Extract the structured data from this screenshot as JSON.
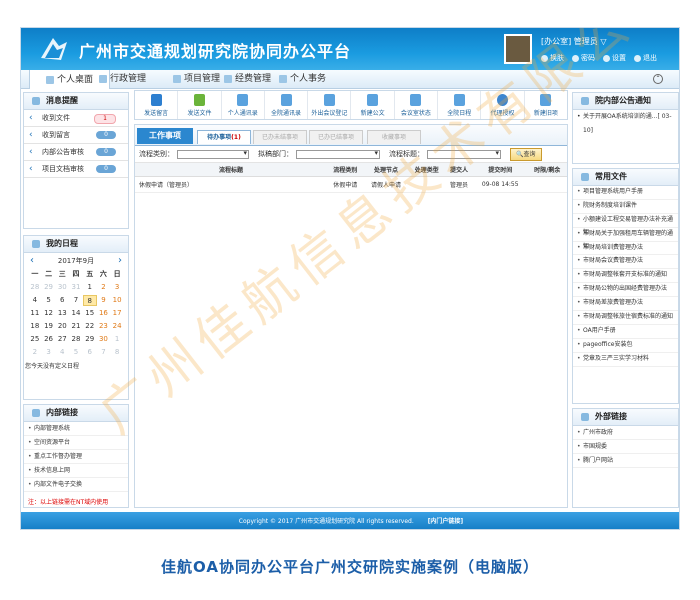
{
  "app": {
    "title": "广州市交通规划研究院协同办公平台"
  },
  "user": {
    "name": "[办公室] 管理员 ▽",
    "actions": [
      "换肤",
      "密码",
      "设置",
      "退出"
    ]
  },
  "nav": {
    "items": [
      "个人桌面",
      "行政管理",
      "项目管理",
      "经费管理",
      "个人事务"
    ]
  },
  "messages": {
    "title": "消息提醒",
    "items": [
      {
        "label": "收到文件",
        "count": "1",
        "highlight": true
      },
      {
        "label": "收到留言",
        "count": "0",
        "highlight": false
      },
      {
        "label": "内部公告审核",
        "count": "0",
        "highlight": false
      },
      {
        "label": "项目文档审核",
        "count": "0",
        "highlight": false
      }
    ]
  },
  "schedule": {
    "title": "我的日程",
    "month": "2017年9月",
    "weekdays": [
      "一",
      "二",
      "三",
      "四",
      "五",
      "六",
      "日"
    ],
    "days": [
      "28",
      "29",
      "30",
      "31",
      "1",
      "2",
      "3",
      "4",
      "5",
      "6",
      "7",
      "8",
      "9",
      "10",
      "11",
      "12",
      "13",
      "14",
      "15",
      "16",
      "17",
      "18",
      "19",
      "20",
      "21",
      "22",
      "23",
      "24",
      "25",
      "26",
      "27",
      "28",
      "29",
      "30",
      "1",
      "2",
      "3",
      "4",
      "5",
      "6",
      "7",
      "8"
    ],
    "note": "您今天没有定义日程"
  },
  "links": {
    "title": "内部链接",
    "items": [
      "内部管理系统",
      "空间资源平台",
      "重点工作督办管理",
      "技术信息上网",
      "内部文件电子交换"
    ],
    "note": "注：以上链接需在NT域内使用"
  },
  "toolbar": {
    "buttons": [
      "发送留言",
      "发送文件",
      "个人通讯录",
      "全院通讯录",
      "外出会议登记",
      "新建公文",
      "会议室状态",
      "全院日程",
      "代理授权",
      "新建旧项"
    ]
  },
  "work": {
    "tab_title": "工作事项",
    "tabs": [
      "待办事项",
      "已办未结事项",
      "已办已结事项",
      "收藏事项"
    ],
    "pending_count": "(1)",
    "filter": {
      "type_label": "流程类别：",
      "dept_label": "拟稿部门：",
      "title_label": "流程标题：",
      "query": "查询"
    },
    "columns": [
      "流程标题",
      "流程类别",
      "处理节点",
      "处理类型",
      "提交人",
      "提交时间",
      "时限/剩余"
    ],
    "rows": [
      {
        "title": "休假申请（管理员）",
        "type": "休假申请",
        "node": "请假人申请",
        "handle": "",
        "submitter": "管理员",
        "time": "09-08 14:55",
        "limit": ""
      }
    ]
  },
  "announce": {
    "title": "院内部公告通知",
    "items": [
      "关于开展OA系统培训的通...[ 03-10]"
    ]
  },
  "files": {
    "title": "常用文件",
    "items": [
      "项目管理系统用户手册",
      "院财务制度培训课件",
      "小额建设工程交易管理办法补充通知",
      "市财局关于加强租用车辆管理的通知",
      "市财局培训费管理办法",
      "市财局会议费管理办法",
      "市财局调整帐套开支标准的通知",
      "市财局公物的出国经费管理办法",
      "市财局差旅费管理办法",
      "市财局调整帐旅住宿费标准的通知",
      "OA用户手册",
      "pageoffice安装包",
      "党章及三严三实学习材料"
    ]
  },
  "external": {
    "title": "外部链接",
    "items": [
      "广州市政府",
      "市国规委",
      "腾门户网站"
    ]
  },
  "footer": {
    "copyright": "Copyright © 2017 广州市交通规划研究院 All rights reserved.",
    "link": "[内门户链接]"
  },
  "watermark": "广州佳航信息技术有限公司",
  "caption": "佳航OA协同办公平台广州交研院实施案例（电脑版）"
}
